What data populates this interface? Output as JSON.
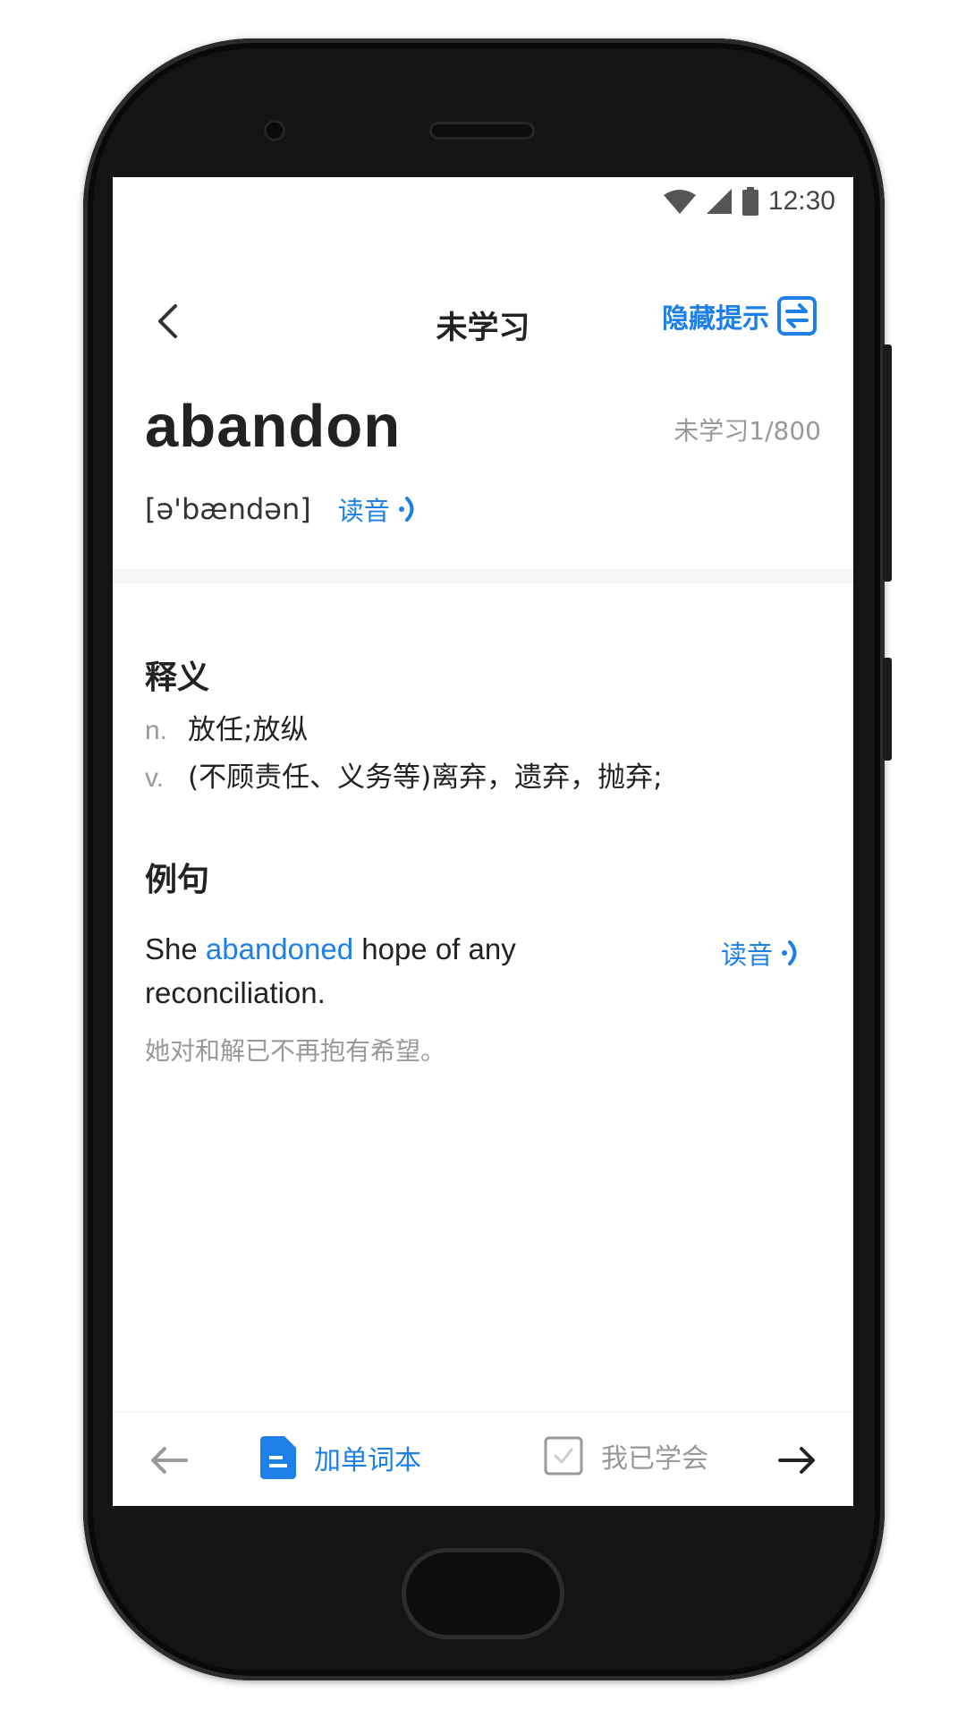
{
  "status_bar": {
    "time": "12:30"
  },
  "header": {
    "title": "未学习",
    "hide_hint_label": "隐藏提示"
  },
  "word": {
    "text": "abandon",
    "progress": "未学习1/800",
    "phonetic": "[ə'bændən]",
    "read_label": "读音"
  },
  "definitions": {
    "heading": "释义",
    "items": [
      {
        "pos": "n.",
        "meaning": "放任;放纵"
      },
      {
        "pos": "v.",
        "meaning": "(不顾责任、义务等)离弃，遗弃，抛弃;"
      }
    ]
  },
  "example": {
    "heading": "例句",
    "before": "She ",
    "highlight": "abandoned",
    "after": " hope of any reconciliation.",
    "read_label": "读音",
    "translation": "她对和解已不再抱有希望。"
  },
  "bottom_bar": {
    "add_label": "加单词本",
    "learned_label": "我已学会"
  },
  "colors": {
    "accent": "#1e7fe8",
    "text_primary": "#222222",
    "text_secondary": "#999999",
    "divider": "#f5f5f5"
  },
  "icons": {
    "back": "chevron-left-icon",
    "hide_hint": "swap-icon",
    "audio": "sound-wave-icon",
    "prev": "arrow-left-icon",
    "next": "arrow-right-icon",
    "add": "document-icon",
    "learned": "checkbox-icon"
  }
}
